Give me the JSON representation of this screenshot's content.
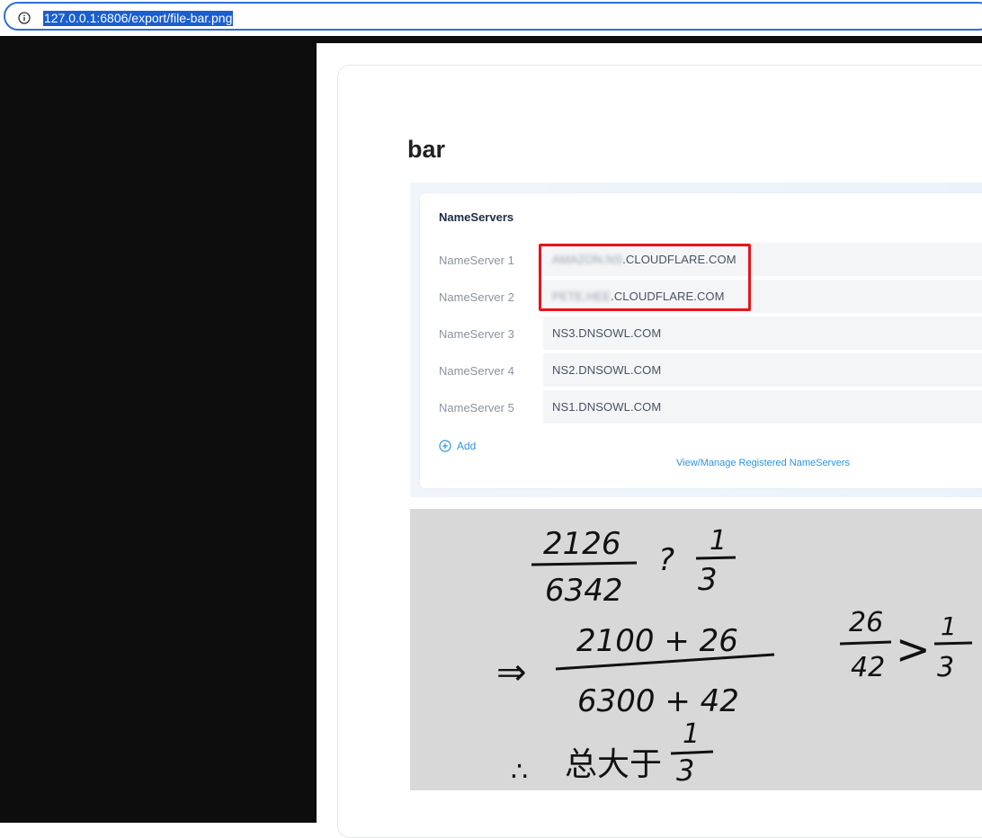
{
  "browser": {
    "url": "127.0.0.1:6806/export/file-bar.png"
  },
  "page": {
    "title": "bar"
  },
  "nameservers": {
    "heading": "NameServers",
    "rows": [
      {
        "label": "NameServer 1",
        "value_blurred": "AMAZON.NS",
        "value": ".CLOUDFLARE.COM"
      },
      {
        "label": "NameServer 2",
        "value_blurred": "PETE.HEE",
        "value": ".CLOUDFLARE.COM"
      },
      {
        "label": "NameServer 3",
        "value": "NS3.DNSOWL.COM"
      },
      {
        "label": "NameServer 4",
        "value": "NS2.DNSOWL.COM"
      },
      {
        "label": "NameServer 5",
        "value": "NS1.DNSOWL.COM"
      }
    ],
    "add_label": "Add",
    "manage_link": "View/Manage Registered NameServers"
  },
  "colors": {
    "accent": "#2b95e0",
    "highlight_box": "#e8141c",
    "url_selection": "#1a5fd0"
  },
  "icons": {
    "address_info": "info-icon",
    "add": "plus-circle-icon"
  },
  "handwriting": {
    "line1_num": "2126",
    "line1_den": "6342",
    "line1_op": "?",
    "line1_right_num": "1",
    "line1_right_den": "3",
    "line2_arrow": "⇒",
    "line2_num": "2100 + 26",
    "line2_den": "6300 + 42",
    "line2_cmp_num": "26",
    "line2_cmp_den": "42",
    "line2_cmp_op": ">",
    "line2_cmp_right_num": "1",
    "line2_cmp_right_den": "3",
    "line3_therefore": "∴",
    "line3_text": "总大于",
    "line3_num": "1",
    "line3_den": "3"
  }
}
